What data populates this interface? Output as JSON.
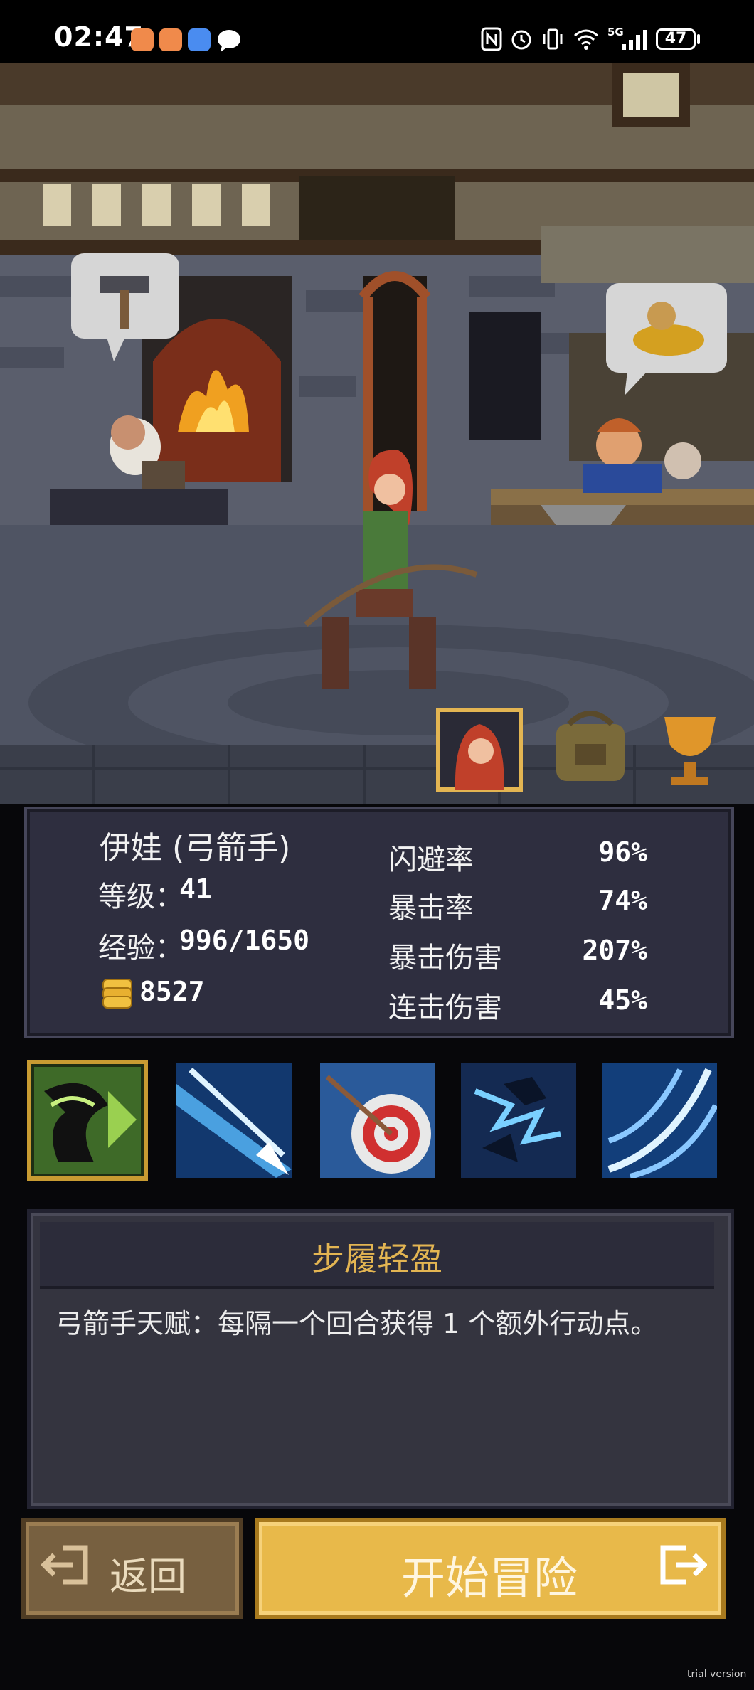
{
  "status_bar": {
    "time": "02:47",
    "network": "5G",
    "battery": "47"
  },
  "hero": {
    "name": "伊娃 (弓箭手)",
    "level_label": "等级：",
    "level": "41",
    "exp_label": "经验：",
    "exp": "996/1650",
    "gold": "8527"
  },
  "stats": [
    {
      "label": "闪避率",
      "value": "96%"
    },
    {
      "label": "暴击率",
      "value": "74%"
    },
    {
      "label": "暴击伤害",
      "value": "207%"
    },
    {
      "label": "连击伤害",
      "value": "45%"
    }
  ],
  "tabs": [
    {
      "icon": "hero-portrait-icon"
    },
    {
      "icon": "backpack-icon"
    },
    {
      "icon": "trophy-icon"
    }
  ],
  "skills": [
    {
      "icon": "swift-step-icon",
      "selected": true
    },
    {
      "icon": "piercing-arrow-icon",
      "selected": false
    },
    {
      "icon": "bullseye-shot-icon",
      "selected": false
    },
    {
      "icon": "lightning-raven-icon",
      "selected": false
    },
    {
      "icon": "wind-swirl-icon",
      "selected": false
    }
  ],
  "skill_detail": {
    "title": "步履轻盈",
    "description": "弓箭手天赋：每隔一个回合获得 1 个额外行动点。"
  },
  "buttons": {
    "back": "返回",
    "start": "开始冒险"
  },
  "watermark": "trial version",
  "colors": {
    "accent_gold": "#e8b94a",
    "title_gold": "#e3b552",
    "panel_bg": "#2e2e3f",
    "back_button": "#776040"
  }
}
